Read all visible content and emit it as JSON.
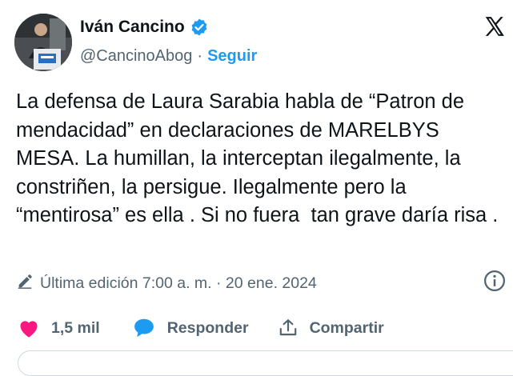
{
  "author": {
    "name": "Iván Cancino",
    "handle": "@CancinoAbog",
    "separator": "·",
    "follow_label": "Seguir"
  },
  "tweet": {
    "text": "La defensa de Laura Sarabia habla de “Patron de mendacidad” en declaraciones de MARELBYS MESA. La humillan, la interceptan ilegalmente, la constriñen, la persigue. Ilegalmente pero la “mentirosa” es ella . Si no fuera  tan grave daría risa .",
    "edited_label": "Última edición 7:00 a. m. · 20 ene. 2024"
  },
  "actions": {
    "likes": "1,5 mil",
    "reply_label": "Responder",
    "share_label": "Compartir"
  },
  "colors": {
    "accent": "#1d9bf0",
    "like": "#f91880",
    "muted": "#536471"
  },
  "icons": [
    "verified-badge-icon",
    "x-logo-icon",
    "edit-pencil-icon",
    "info-icon",
    "heart-icon",
    "reply-bubble-icon",
    "share-icon"
  ]
}
